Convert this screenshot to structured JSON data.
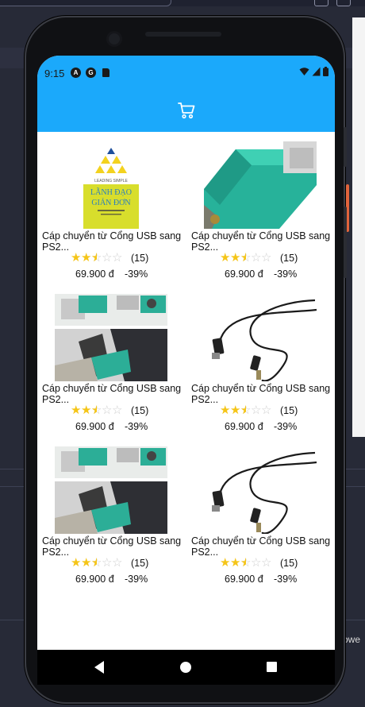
{
  "status": {
    "time": "9:15"
  },
  "icons": {
    "cart": "cart-icon",
    "back": "back-icon",
    "home": "home-icon",
    "recents": "recents-icon"
  },
  "colors": {
    "accent": "#1ba9fb",
    "star": "#f5c518"
  },
  "desktop": {
    "side_text": "owe"
  },
  "products": [
    {
      "title": "Cáp chuyển từ Cổng USB sang PS2...",
      "rating": 2.5,
      "reviews": "(15)",
      "price": "69.900 đ",
      "discount": "-39%",
      "image": "book-cover"
    },
    {
      "title": "Cáp chuyển từ Cổng USB sang PS2...",
      "rating": 2.5,
      "reviews": "(15)",
      "price": "69.900 đ",
      "discount": "-39%",
      "image": "green-adapter"
    },
    {
      "title": "Cáp chuyển từ Cổng USB sang PS2...",
      "rating": 2.5,
      "reviews": "(15)",
      "price": "69.900 đ",
      "discount": "-39%",
      "image": "adapter-in-use"
    },
    {
      "title": "Cáp chuyển từ Cổng USB sang PS2...",
      "rating": 2.5,
      "reviews": "(15)",
      "price": "69.900 đ",
      "discount": "-39%",
      "image": "black-cable"
    },
    {
      "title": "Cáp chuyển từ Cổng USB sang PS2...",
      "rating": 2.5,
      "reviews": "(15)",
      "price": "69.900 đ",
      "discount": "-39%",
      "image": "adapter-in-use"
    },
    {
      "title": "Cáp chuyển từ Cổng USB sang PS2...",
      "rating": 2.5,
      "reviews": "(15)",
      "price": "69.900 đ",
      "discount": "-39%",
      "image": "black-cable"
    }
  ],
  "book_cover": {
    "line1": "LEADING SIMPLE",
    "line2": "LÃNH ĐẠO",
    "line3": "GIẢN ĐƠN"
  }
}
